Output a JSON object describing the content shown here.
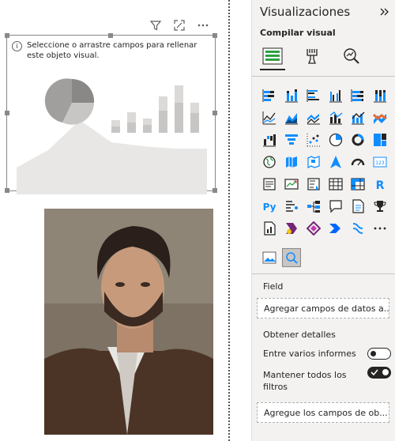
{
  "canvas": {
    "empty_visual_message": "Seleccione o arrastre campos para rellenar este objeto visual."
  },
  "pane": {
    "title": "Visualizaciones",
    "subtitle": "Compilar visual",
    "field_section": "Field",
    "field_well_placeholder": "Agregar campos de datos a...",
    "details_section": "Obtener detalles",
    "cross_report_label": "Entre varios informes",
    "cross_report_on": false,
    "keep_filters_label": "Mantener todos los filtros",
    "keep_filters_on": true,
    "drillthrough_well_placeholder": "Agregue los campos de ob..."
  },
  "visual_types": [
    "stacked-bar-chart-icon",
    "stacked-column-chart-icon",
    "clustered-bar-chart-icon",
    "clustered-column-chart-icon",
    "100-stacked-bar-icon",
    "100-stacked-column-icon",
    "line-chart-icon",
    "area-chart-icon",
    "stacked-area-icon",
    "line-clustered-column-icon",
    "line-stacked-column-icon",
    "ribbon-chart-icon",
    "waterfall-chart-icon",
    "funnel-chart-icon",
    "scatter-chart-icon",
    "pie-chart-icon",
    "donut-chart-icon",
    "treemap-icon",
    "map-icon",
    "filled-map-icon",
    "shape-map-icon",
    "azure-map-icon",
    "gauge-icon",
    "card-icon",
    "multi-row-card-icon",
    "kpi-icon",
    "slicer-icon",
    "table-icon",
    "matrix-icon",
    "r-visual-icon",
    "python-visual-icon",
    "key-influencers-icon",
    "decomposition-tree-icon",
    "qa-icon",
    "smart-narrative-icon",
    "trophy-icon",
    "paginated-report-icon",
    "power-apps-icon",
    "power-automate-icon",
    "chevron-icon",
    "sparkle-icon",
    "more-visuals-icon"
  ],
  "colors": {
    "accent": "#118dff",
    "pane_bg": "#f3f2f1",
    "yellow": "#f2c811"
  }
}
